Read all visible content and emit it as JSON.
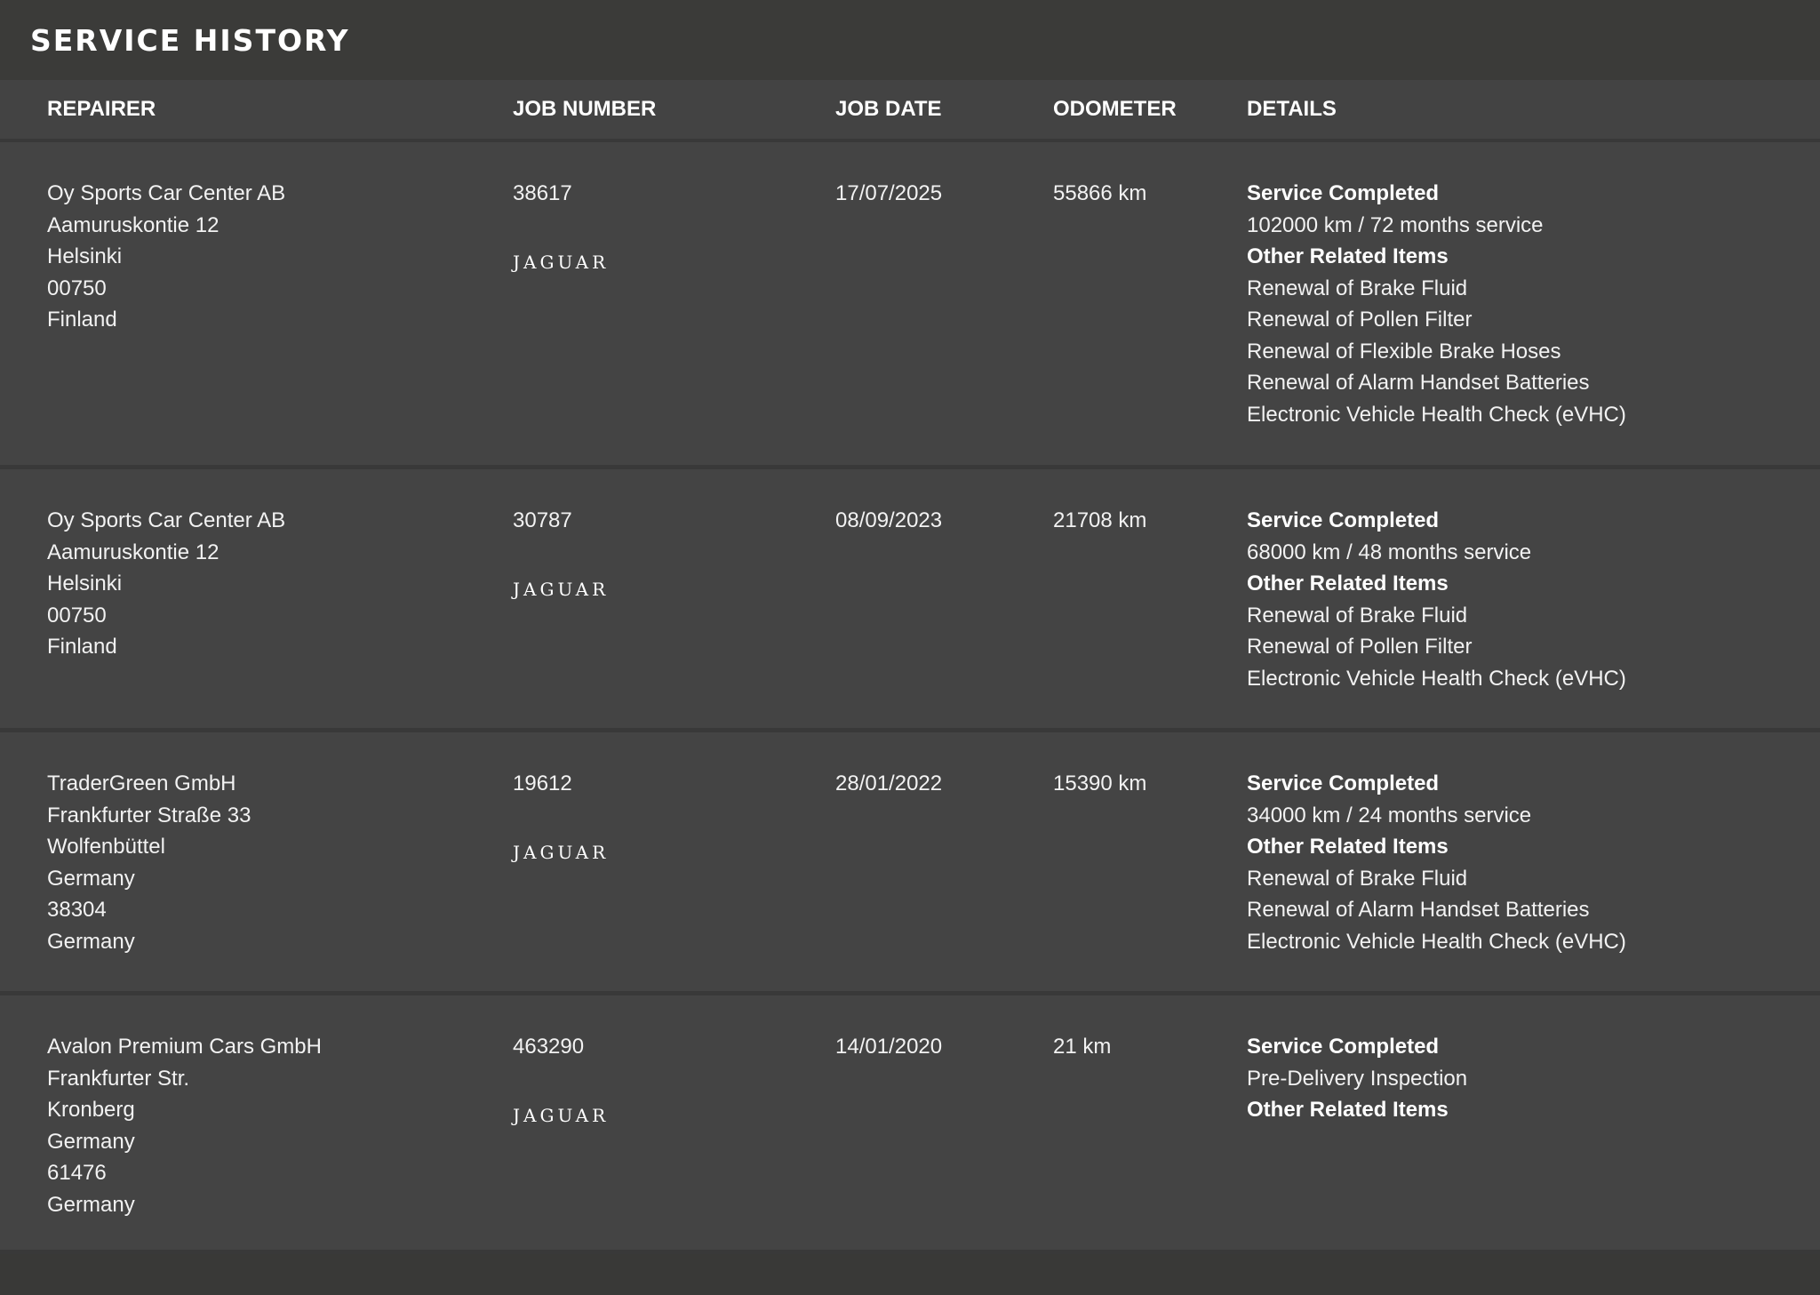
{
  "page": {
    "title": "SERVICE HISTORY"
  },
  "table": {
    "headers": [
      "REPAIRER",
      "JOB NUMBER",
      "JOB DATE",
      "ODOMETER",
      "DETAILS"
    ],
    "rows": [
      {
        "repairer": [
          "Oy Sports Car Center AB",
          "Aamuruskontie 12",
          "Helsinki",
          "00750",
          "Finland"
        ],
        "job_number": "38617",
        "brand_logo": "JAGUAR",
        "job_date": "17/07/2025",
        "odometer": "55866 km",
        "details": [
          {
            "text": "Service Completed",
            "strong": true
          },
          {
            "text": "102000 km / 72 months service",
            "strong": false
          },
          {
            "text": "Other Related Items",
            "strong": true
          },
          {
            "text": "Renewal of Brake Fluid",
            "strong": false
          },
          {
            "text": "Renewal of Pollen Filter",
            "strong": false
          },
          {
            "text": "Renewal of Flexible Brake Hoses",
            "strong": false
          },
          {
            "text": "Renewal of Alarm Handset Batteries",
            "strong": false
          },
          {
            "text": "Electronic Vehicle Health Check (eVHC)",
            "strong": false
          }
        ]
      },
      {
        "repairer": [
          "Oy Sports Car Center AB",
          "Aamuruskontie 12",
          "Helsinki",
          "00750",
          "Finland"
        ],
        "job_number": "30787",
        "brand_logo": "JAGUAR",
        "job_date": "08/09/2023",
        "odometer": "21708 km",
        "details": [
          {
            "text": "Service Completed",
            "strong": true
          },
          {
            "text": "68000 km / 48 months service",
            "strong": false
          },
          {
            "text": "Other Related Items",
            "strong": true
          },
          {
            "text": "Renewal of Brake Fluid",
            "strong": false
          },
          {
            "text": "Renewal of Pollen Filter",
            "strong": false
          },
          {
            "text": "Electronic Vehicle Health Check (eVHC)",
            "strong": false
          }
        ]
      },
      {
        "repairer": [
          "TraderGreen GmbH",
          "Frankfurter Straße 33",
          "Wolfenbüttel",
          "Germany",
          "38304",
          "Germany"
        ],
        "job_number": "19612",
        "brand_logo": "JAGUAR",
        "job_date": "28/01/2022",
        "odometer": "15390 km",
        "details": [
          {
            "text": "Service Completed",
            "strong": true
          },
          {
            "text": "34000 km / 24 months service",
            "strong": false
          },
          {
            "text": "Other Related Items",
            "strong": true
          },
          {
            "text": "Renewal of Brake Fluid",
            "strong": false
          },
          {
            "text": "Renewal of Alarm Handset Batteries",
            "strong": false
          },
          {
            "text": "Electronic Vehicle Health Check (eVHC)",
            "strong": false
          }
        ]
      },
      {
        "repairer": [
          "Avalon Premium Cars GmbH",
          "Frankfurter Str.",
          "Kronberg",
          "Germany",
          "61476",
          "Germany"
        ],
        "job_number": "463290",
        "brand_logo": "JAGUAR",
        "job_date": "14/01/2020",
        "odometer": "21 km",
        "details": [
          {
            "text": "Service Completed",
            "strong": true
          },
          {
            "text": "Pre-Delivery Inspection",
            "strong": false
          },
          {
            "text": "Other Related Items",
            "strong": true
          }
        ]
      }
    ]
  },
  "colors": {
    "background": "#3b3b39",
    "table_row": "#444444",
    "divider": "#393939",
    "text": "#f4f4f4"
  },
  "icons": {
    "brand_logo": "jaguar-logo-icon"
  }
}
